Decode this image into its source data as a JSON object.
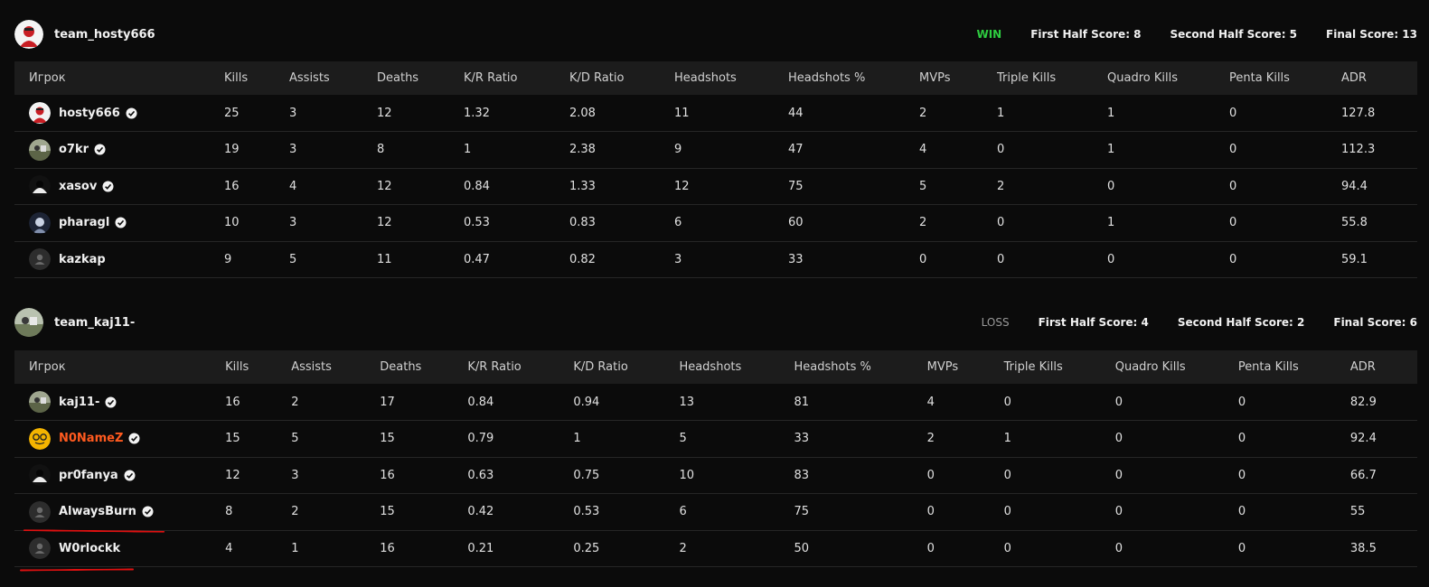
{
  "teams": [
    {
      "name": "team_hosty666",
      "result": "WIN",
      "first_half": "First Half Score: 8",
      "second_half": "Second Half Score: 5",
      "final": "Final Score: 13",
      "columns": [
        "Игрок",
        "Kills",
        "Assists",
        "Deaths",
        "K/R Ratio",
        "K/D Ratio",
        "Headshots",
        "Headshots %",
        "MVPs",
        "Triple Kills",
        "Quadro Kills",
        "Penta Kills",
        "ADR"
      ],
      "players": [
        {
          "name": "hosty666",
          "verified": true,
          "avatar": "red",
          "stats": [
            "25",
            "3",
            "12",
            "1.32",
            "2.08",
            "11",
            "44",
            "2",
            "1",
            "1",
            "0",
            "127.8"
          ]
        },
        {
          "name": "o7kr",
          "verified": true,
          "avatar": "photo",
          "stats": [
            "19",
            "3",
            "8",
            "1",
            "2.38",
            "9",
            "47",
            "4",
            "0",
            "1",
            "0",
            "112.3"
          ]
        },
        {
          "name": "xasov",
          "verified": true,
          "avatar": "dark",
          "stats": [
            "16",
            "4",
            "12",
            "0.84",
            "1.33",
            "12",
            "75",
            "5",
            "2",
            "0",
            "0",
            "94.4"
          ]
        },
        {
          "name": "pharagl",
          "verified": true,
          "avatar": "anime",
          "stats": [
            "10",
            "3",
            "12",
            "0.53",
            "0.83",
            "6",
            "60",
            "2",
            "0",
            "1",
            "0",
            "55.8"
          ]
        },
        {
          "name": "kazkap",
          "verified": false,
          "avatar": "default",
          "stats": [
            "9",
            "5",
            "11",
            "0.47",
            "0.82",
            "3",
            "33",
            "0",
            "0",
            "0",
            "0",
            "59.1"
          ]
        }
      ]
    },
    {
      "name": "team_kaj11-",
      "result": "LOSS",
      "first_half": "First Half Score: 4",
      "second_half": "Second Half Score: 2",
      "final": "Final Score: 6",
      "columns": [
        "Игрок",
        "Kills",
        "Assists",
        "Deaths",
        "K/R Ratio",
        "K/D Ratio",
        "Headshots",
        "Headshots %",
        "MVPs",
        "Triple Kills",
        "Quadro Kills",
        "Penta Kills",
        "ADR"
      ],
      "players": [
        {
          "name": "kaj11-",
          "verified": true,
          "avatar": "photo",
          "stats": [
            "16",
            "2",
            "17",
            "0.84",
            "0.94",
            "13",
            "81",
            "4",
            "0",
            "0",
            "0",
            "82.9"
          ]
        },
        {
          "name": "N0NameZ",
          "verified": true,
          "avatar": "emoji",
          "highlight": true,
          "stats": [
            "15",
            "5",
            "15",
            "0.79",
            "1",
            "5",
            "33",
            "2",
            "1",
            "0",
            "0",
            "92.4"
          ]
        },
        {
          "name": "pr0fanya",
          "verified": true,
          "avatar": "dark",
          "stats": [
            "12",
            "3",
            "16",
            "0.63",
            "0.75",
            "10",
            "83",
            "0",
            "0",
            "0",
            "0",
            "66.7"
          ]
        },
        {
          "name": "AlwaysBurn",
          "verified": true,
          "avatar": "default",
          "stats": [
            "8",
            "2",
            "15",
            "0.42",
            "0.53",
            "6",
            "75",
            "0",
            "0",
            "0",
            "0",
            "55"
          ]
        },
        {
          "name": "W0rlockk",
          "verified": false,
          "avatar": "default",
          "stats": [
            "4",
            "1",
            "16",
            "0.21",
            "0.25",
            "2",
            "50",
            "0",
            "0",
            "0",
            "0",
            "38.5"
          ]
        }
      ]
    }
  ],
  "colors": {
    "win": "#2ecc40",
    "loss": "#9a9a9a",
    "highlight": "#ff5a1f",
    "annotation": "#e01010"
  }
}
